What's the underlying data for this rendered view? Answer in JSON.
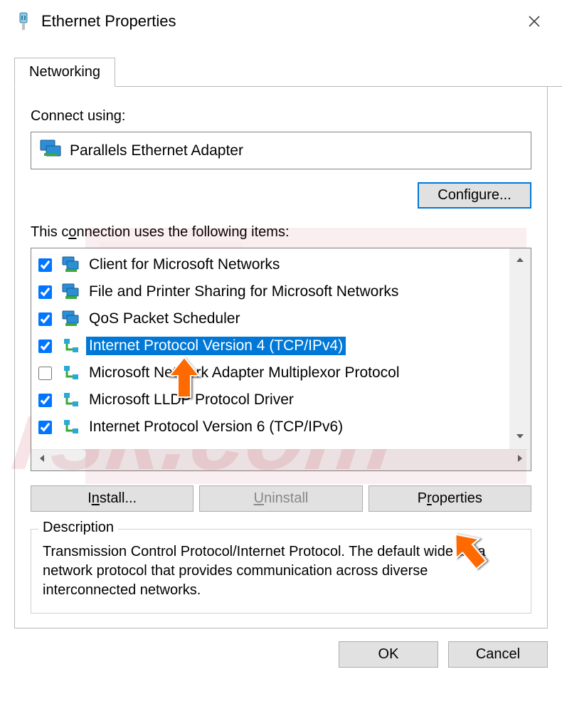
{
  "window": {
    "title": "Ethernet Properties",
    "close_icon": "close-icon"
  },
  "tabs": [
    {
      "label": "Networking",
      "active": true
    }
  ],
  "connect_using_label": "Connect using:",
  "adapter_name": "Parallels Ethernet Adapter",
  "configure_button": "Configure...",
  "items_label": "This connection uses the following items:",
  "items": [
    {
      "checked": true,
      "label": "Client for Microsoft Networks",
      "icon": "monitor-icon",
      "selected": false
    },
    {
      "checked": true,
      "label": "File and Printer Sharing for Microsoft Networks",
      "icon": "monitor-icon",
      "selected": false
    },
    {
      "checked": true,
      "label": "QoS Packet Scheduler",
      "icon": "monitor-icon",
      "selected": false
    },
    {
      "checked": true,
      "label": "Internet Protocol Version 4 (TCP/IPv4)",
      "icon": "network-icon",
      "selected": true
    },
    {
      "checked": false,
      "label": "Microsoft Network Adapter Multiplexor Protocol",
      "icon": "network-icon",
      "selected": false
    },
    {
      "checked": true,
      "label": "Microsoft LLDP Protocol Driver",
      "icon": "network-icon",
      "selected": false
    },
    {
      "checked": true,
      "label": "Internet Protocol Version 6 (TCP/IPv6)",
      "icon": "network-icon",
      "selected": false
    }
  ],
  "buttons": {
    "install": "Install...",
    "uninstall": "Uninstall",
    "properties": "Properties"
  },
  "description": {
    "heading": "Description",
    "text": "Transmission Control Protocol/Internet Protocol. The default wide area network protocol that provides communication across diverse interconnected networks."
  },
  "dialog_buttons": {
    "ok": "OK",
    "cancel": "Cancel"
  }
}
